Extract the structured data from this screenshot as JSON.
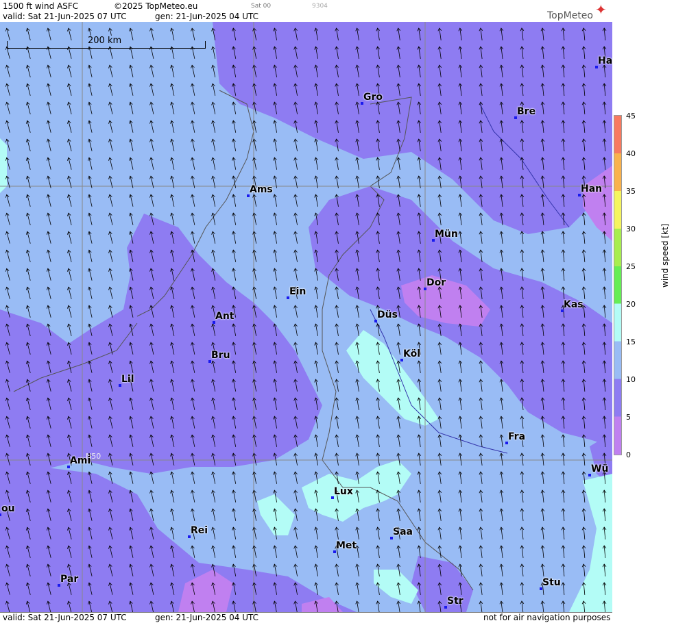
{
  "header": {
    "product": "1500 ft wind ASFC",
    "copyright": "©2025 TopMeteo.eu",
    "day_code": "Sat 00",
    "run_code": "9304",
    "valid": "valid:  Sat  21-Jun-2025  07 UTC",
    "generated": "gen: 21-Jun-2025 04 UTC",
    "logo": "TopMeteo"
  },
  "footer": {
    "valid": "valid:  Sat  21-Jun-2025  07 UTC",
    "generated": "gen: 21-Jun-2025 04 UTC",
    "disclaimer": "not for air navigation purposes"
  },
  "map": {
    "scale_label": "200 km",
    "grid_label": "N50",
    "cities": [
      {
        "name": "Ha"
      },
      {
        "name": "Gro"
      },
      {
        "name": "Bre"
      },
      {
        "name": "Han"
      },
      {
        "name": "Ams"
      },
      {
        "name": "Mün"
      },
      {
        "name": "Dor"
      },
      {
        "name": "Ein"
      },
      {
        "name": "Kas"
      },
      {
        "name": "Ant"
      },
      {
        "name": "Düs"
      },
      {
        "name": "Bru"
      },
      {
        "name": "Köl"
      },
      {
        "name": "Lil"
      },
      {
        "name": "Fra"
      },
      {
        "name": "Ami"
      },
      {
        "name": "Wü"
      },
      {
        "name": "Lux"
      },
      {
        "name": "ou"
      },
      {
        "name": "Rei"
      },
      {
        "name": "Saa"
      },
      {
        "name": "Met"
      },
      {
        "name": "Stu"
      },
      {
        "name": "Par"
      },
      {
        "name": "Str"
      }
    ],
    "wind_speed_colors": {
      "0-5": "#c080f0",
      "5-10": "#8e7cf2",
      "10-15": "#99bcf5",
      "15-20": "#b3fcf6",
      "20-25": "#66ee55",
      "25-30": "#a8ee50",
      "30-35": "#f5f560",
      "35-40": "#f9b24d",
      "40-45": "#f77a60"
    }
  },
  "legend": {
    "title": "wind speed  [kt]",
    "ticks": [
      "45",
      "40",
      "35",
      "30",
      "25",
      "20",
      "15",
      "10",
      "5",
      "0"
    ]
  }
}
